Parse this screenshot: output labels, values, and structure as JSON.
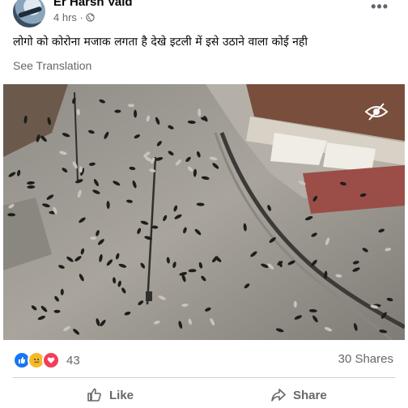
{
  "post": {
    "author": "Er Harsh Vaid",
    "time": "4 hrs ·",
    "text": "लोगो  को कोरोना मजाक लगता है देखे इटली में इसे उठाने वाला कोई नही",
    "see_translation": "See Translation",
    "more_label": "•••"
  },
  "stats": {
    "reaction_count": "43",
    "shares": "30 Shares",
    "reaction_icons": [
      "like-icon",
      "sad-icon",
      "love-icon"
    ]
  },
  "actions": {
    "like": "Like",
    "share": "Share"
  },
  "colors": {
    "accent": "#1877f2",
    "text_secondary": "#65676b",
    "love": "#f33e58",
    "sad": "#f7b928"
  }
}
